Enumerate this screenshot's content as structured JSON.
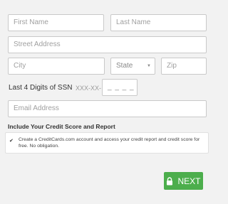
{
  "form": {
    "first_name_placeholder": "First Name",
    "last_name_placeholder": "Last Name",
    "street_placeholder": "Street Address",
    "city_placeholder": "City",
    "state_value": "State",
    "zip_placeholder": "Zip",
    "ssn_label": "Last 4 Digits of SSN",
    "ssn_prefix": "XXX-XX-",
    "ssn_placeholder": "_ _ _ _",
    "email_placeholder": "Email Address"
  },
  "consent": {
    "title": "Include Your Credit Score and Report",
    "checked": true,
    "text": "Create a CreditCards.com account and access your credit report and credit score for free. No obligation."
  },
  "actions": {
    "next_label": "NEXT"
  },
  "icons": {
    "state_dropdown": "chevron-down-icon",
    "checkbox": "checkmark-icon",
    "next": "lock-icon"
  },
  "colors": {
    "background": "#f2f2f2",
    "next_button": "#4cae4c",
    "field_border": "#c9c9c9",
    "placeholder_text": "#a0a0a0"
  }
}
